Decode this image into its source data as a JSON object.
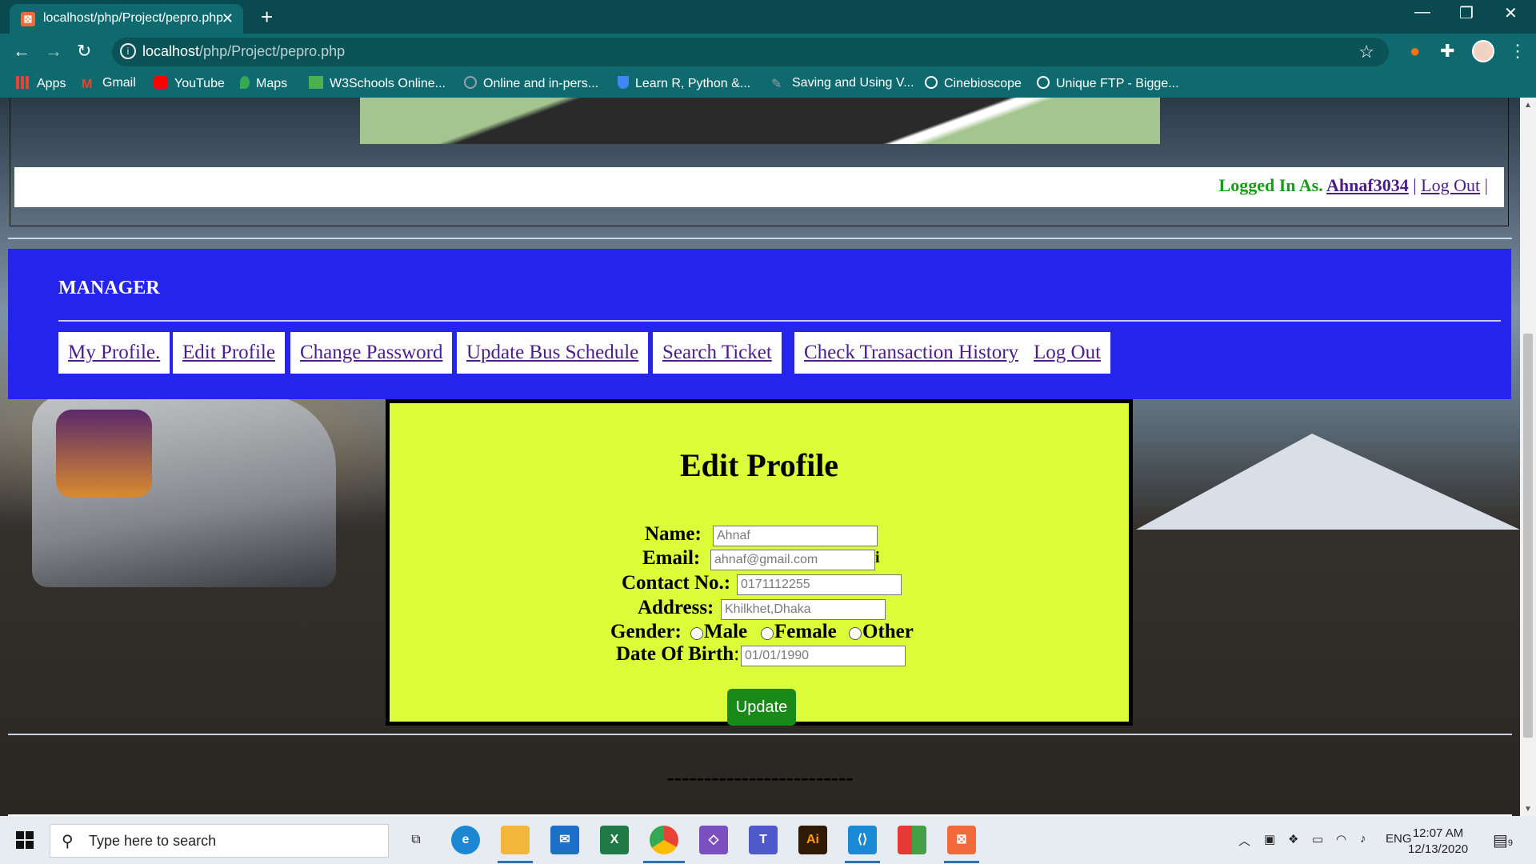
{
  "browser": {
    "tab_title": "localhost/php/Project/pepro.php",
    "url_host": "localhost",
    "url_path": "/php/Project/pepro.php",
    "bookmarks": [
      {
        "label": "Apps",
        "icon": "apps-grid-icon",
        "color": "#ea4335"
      },
      {
        "label": "Gmail",
        "icon": "gmail-icon",
        "color": "#ea4335"
      },
      {
        "label": "YouTube",
        "icon": "youtube-icon",
        "color": "#ff0000"
      },
      {
        "label": "Maps",
        "icon": "maps-pin-icon",
        "color": "#34a853"
      },
      {
        "label": "W3Schools Online...",
        "icon": "w3schools-icon",
        "color": "#4caf50"
      },
      {
        "label": "Online and in-pers...",
        "icon": "site-icon",
        "color": "#9aa0a6"
      },
      {
        "label": "Learn R, Python &...",
        "icon": "shield-icon",
        "color": "#4285f4"
      },
      {
        "label": "Saving and Using V...",
        "icon": "pen-icon",
        "color": "#9aa0a6"
      },
      {
        "label": "Cinebioscope",
        "icon": "globe-icon",
        "color": "#ffffff"
      },
      {
        "label": "Unique FTP - Bigge...",
        "icon": "globe-icon",
        "color": "#ffffff"
      }
    ]
  },
  "page": {
    "logged_in_prefix": "Logged In As.",
    "username": "Ahnaf3034",
    "logout_link": "Log Out",
    "manager_title": "MANAGER",
    "menu": [
      "My Profile.",
      "Edit Profile",
      "Change Password",
      "Update Bus Schedule",
      "Search Ticket",
      "Check Transaction History",
      "Log Out"
    ],
    "form": {
      "title": "Edit Profile",
      "name_label": "Name:",
      "name_value": "Ahnaf",
      "email_label": "Email:",
      "email_value": "ahnaf@gmail.com",
      "email_suffix": "i",
      "contact_label": "Contact No.:",
      "contact_value": "0171112255",
      "address_label": "Address:",
      "address_value": "Khilkhet,Dhaka",
      "gender_label": "Gender:",
      "gender_options": [
        "Male",
        "Female",
        "Other"
      ],
      "dob_label": "Date Of Birth",
      "dob_colon": ":",
      "dob_value": "01/01/1990",
      "update_button": "Update"
    },
    "footer_dashes": "-------------------------"
  },
  "taskbar": {
    "search_placeholder": "Type here to search",
    "language": "ENG",
    "time": "12:07 AM",
    "date": "12/13/2020",
    "notification_count": "9"
  },
  "colors": {
    "manager_panel": "#2424ec",
    "edit_box": "#dcfc3a",
    "update_button": "#198a17",
    "logged_in_text": "#1a9b1a",
    "link": "#4b1d8a"
  }
}
